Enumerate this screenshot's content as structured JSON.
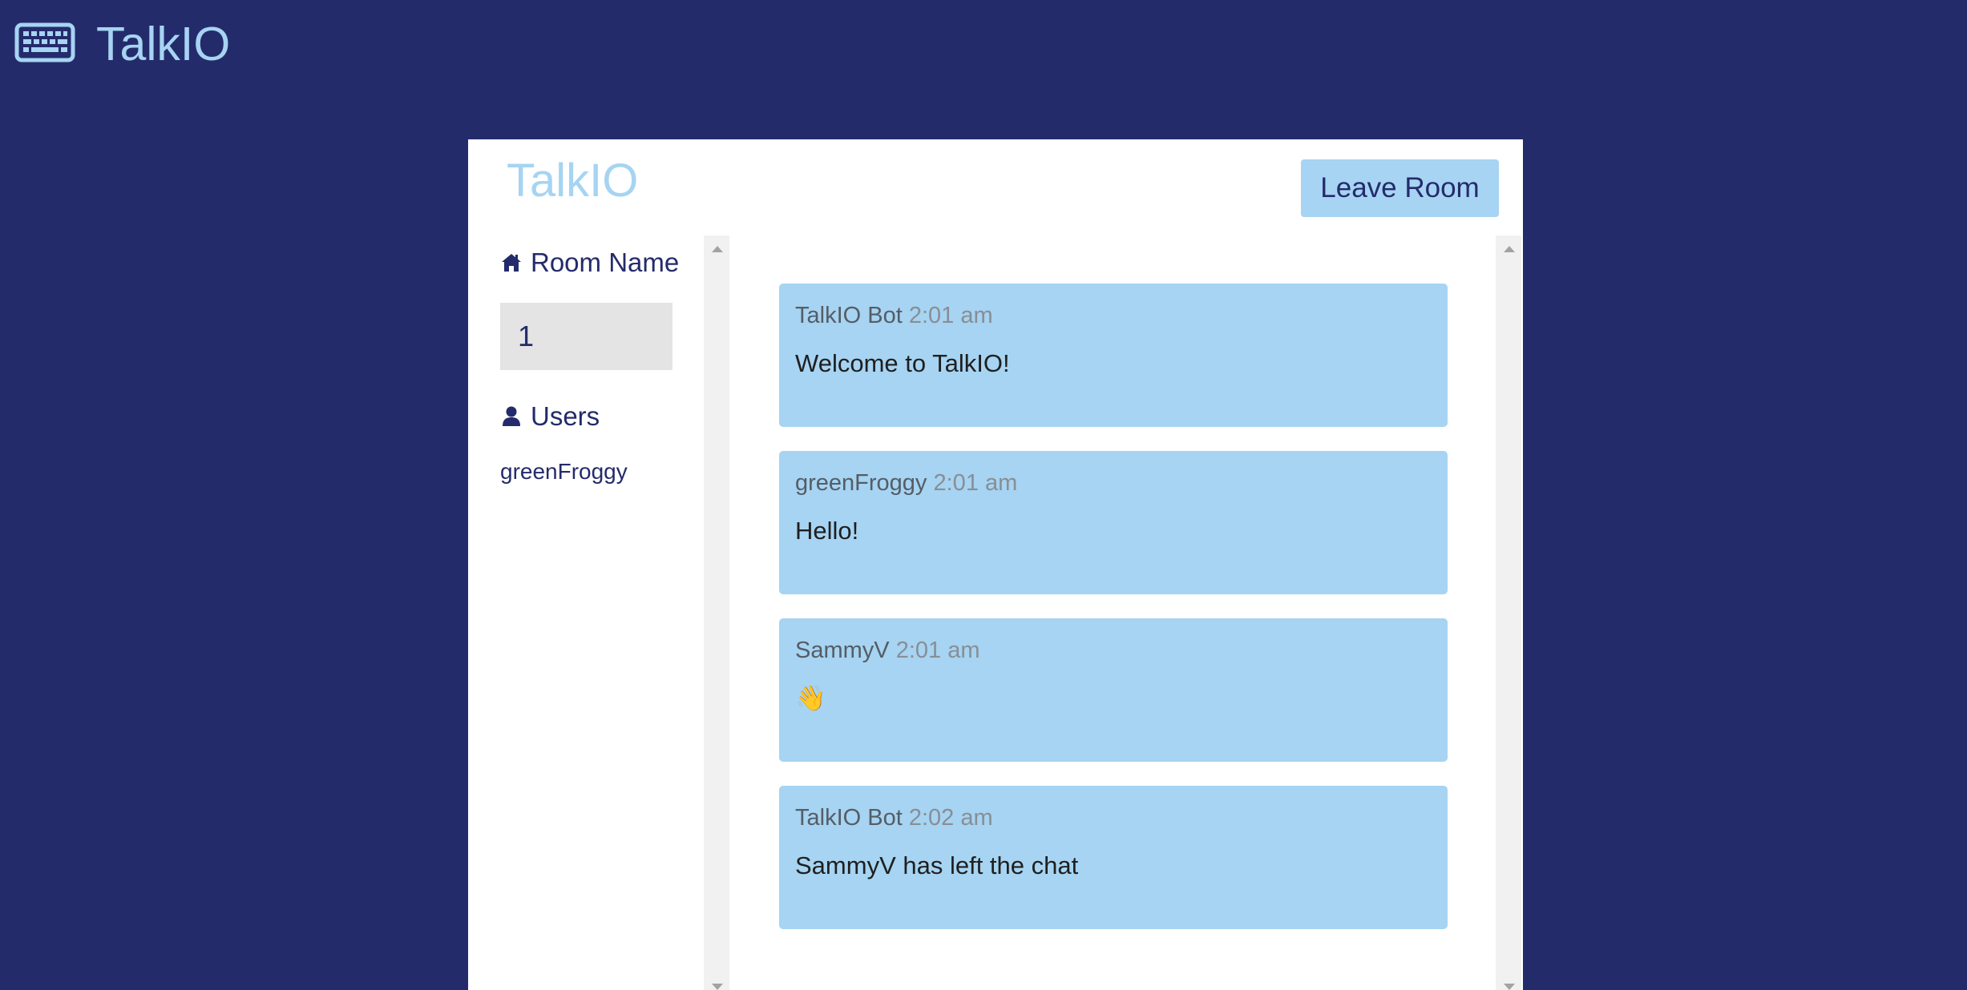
{
  "app": {
    "brand": "TalkIO",
    "logo_icon": "keyboard-icon"
  },
  "panel": {
    "title": "TalkIO",
    "leave_button_label": "Leave Room"
  },
  "sidebar": {
    "room_heading": "Room Name",
    "room_icon": "home-icon",
    "room_value": "1",
    "users_heading": "Users",
    "users_icon": "user-icon",
    "users": [
      "greenFroggy"
    ]
  },
  "messages": [
    {
      "author": "TalkIO Bot",
      "time": "2:01 am",
      "text": "Welcome to TalkIO!"
    },
    {
      "author": "greenFroggy",
      "time": "2:01 am",
      "text": "Hello!"
    },
    {
      "author": "SammyV",
      "time": "2:01 am",
      "text": "👋"
    },
    {
      "author": "TalkIO Bot",
      "time": "2:02 am",
      "text": "SammyV has left the chat"
    }
  ],
  "colors": {
    "background": "#242b6b",
    "accent": "#a6d4f2",
    "panel": "#ffffff"
  }
}
